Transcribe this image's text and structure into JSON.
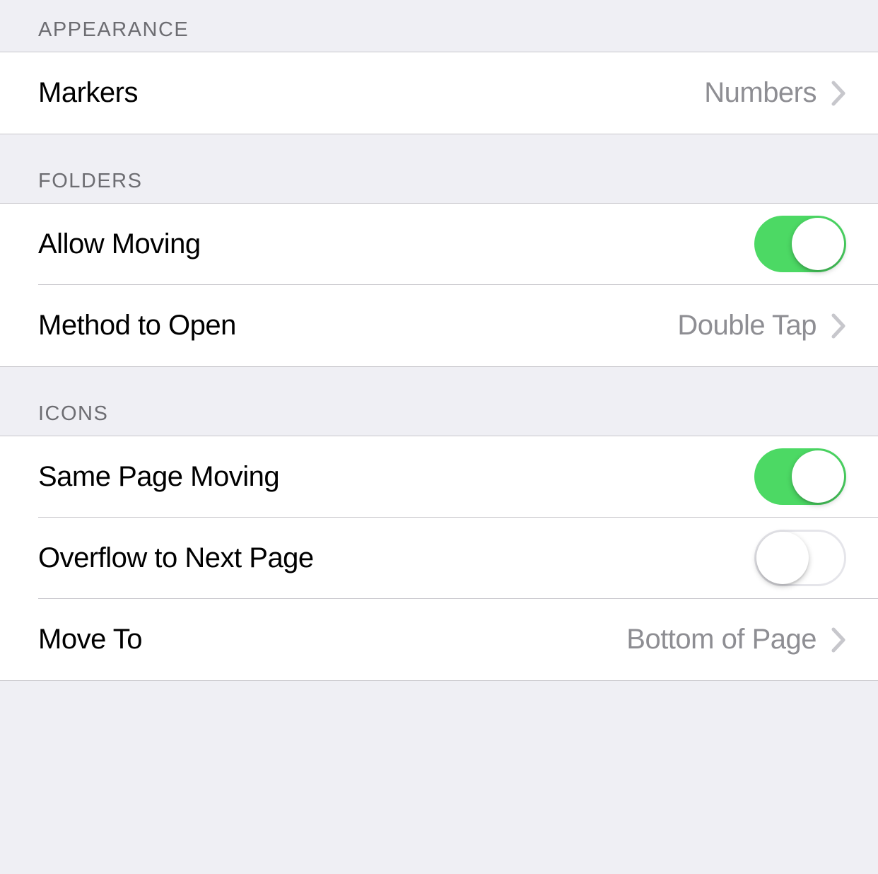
{
  "sections": {
    "appearance": {
      "header": "APPEARANCE",
      "markers": {
        "label": "Markers",
        "value": "Numbers"
      }
    },
    "folders": {
      "header": "FOLDERS",
      "allow_moving": {
        "label": "Allow Moving",
        "on": true
      },
      "method_to_open": {
        "label": "Method to Open",
        "value": "Double Tap"
      }
    },
    "icons": {
      "header": "ICONS",
      "same_page_moving": {
        "label": "Same Page Moving",
        "on": true
      },
      "overflow_next_page": {
        "label": "Overflow to Next Page",
        "on": false
      },
      "move_to": {
        "label": "Move To",
        "value": "Bottom of Page"
      }
    }
  }
}
